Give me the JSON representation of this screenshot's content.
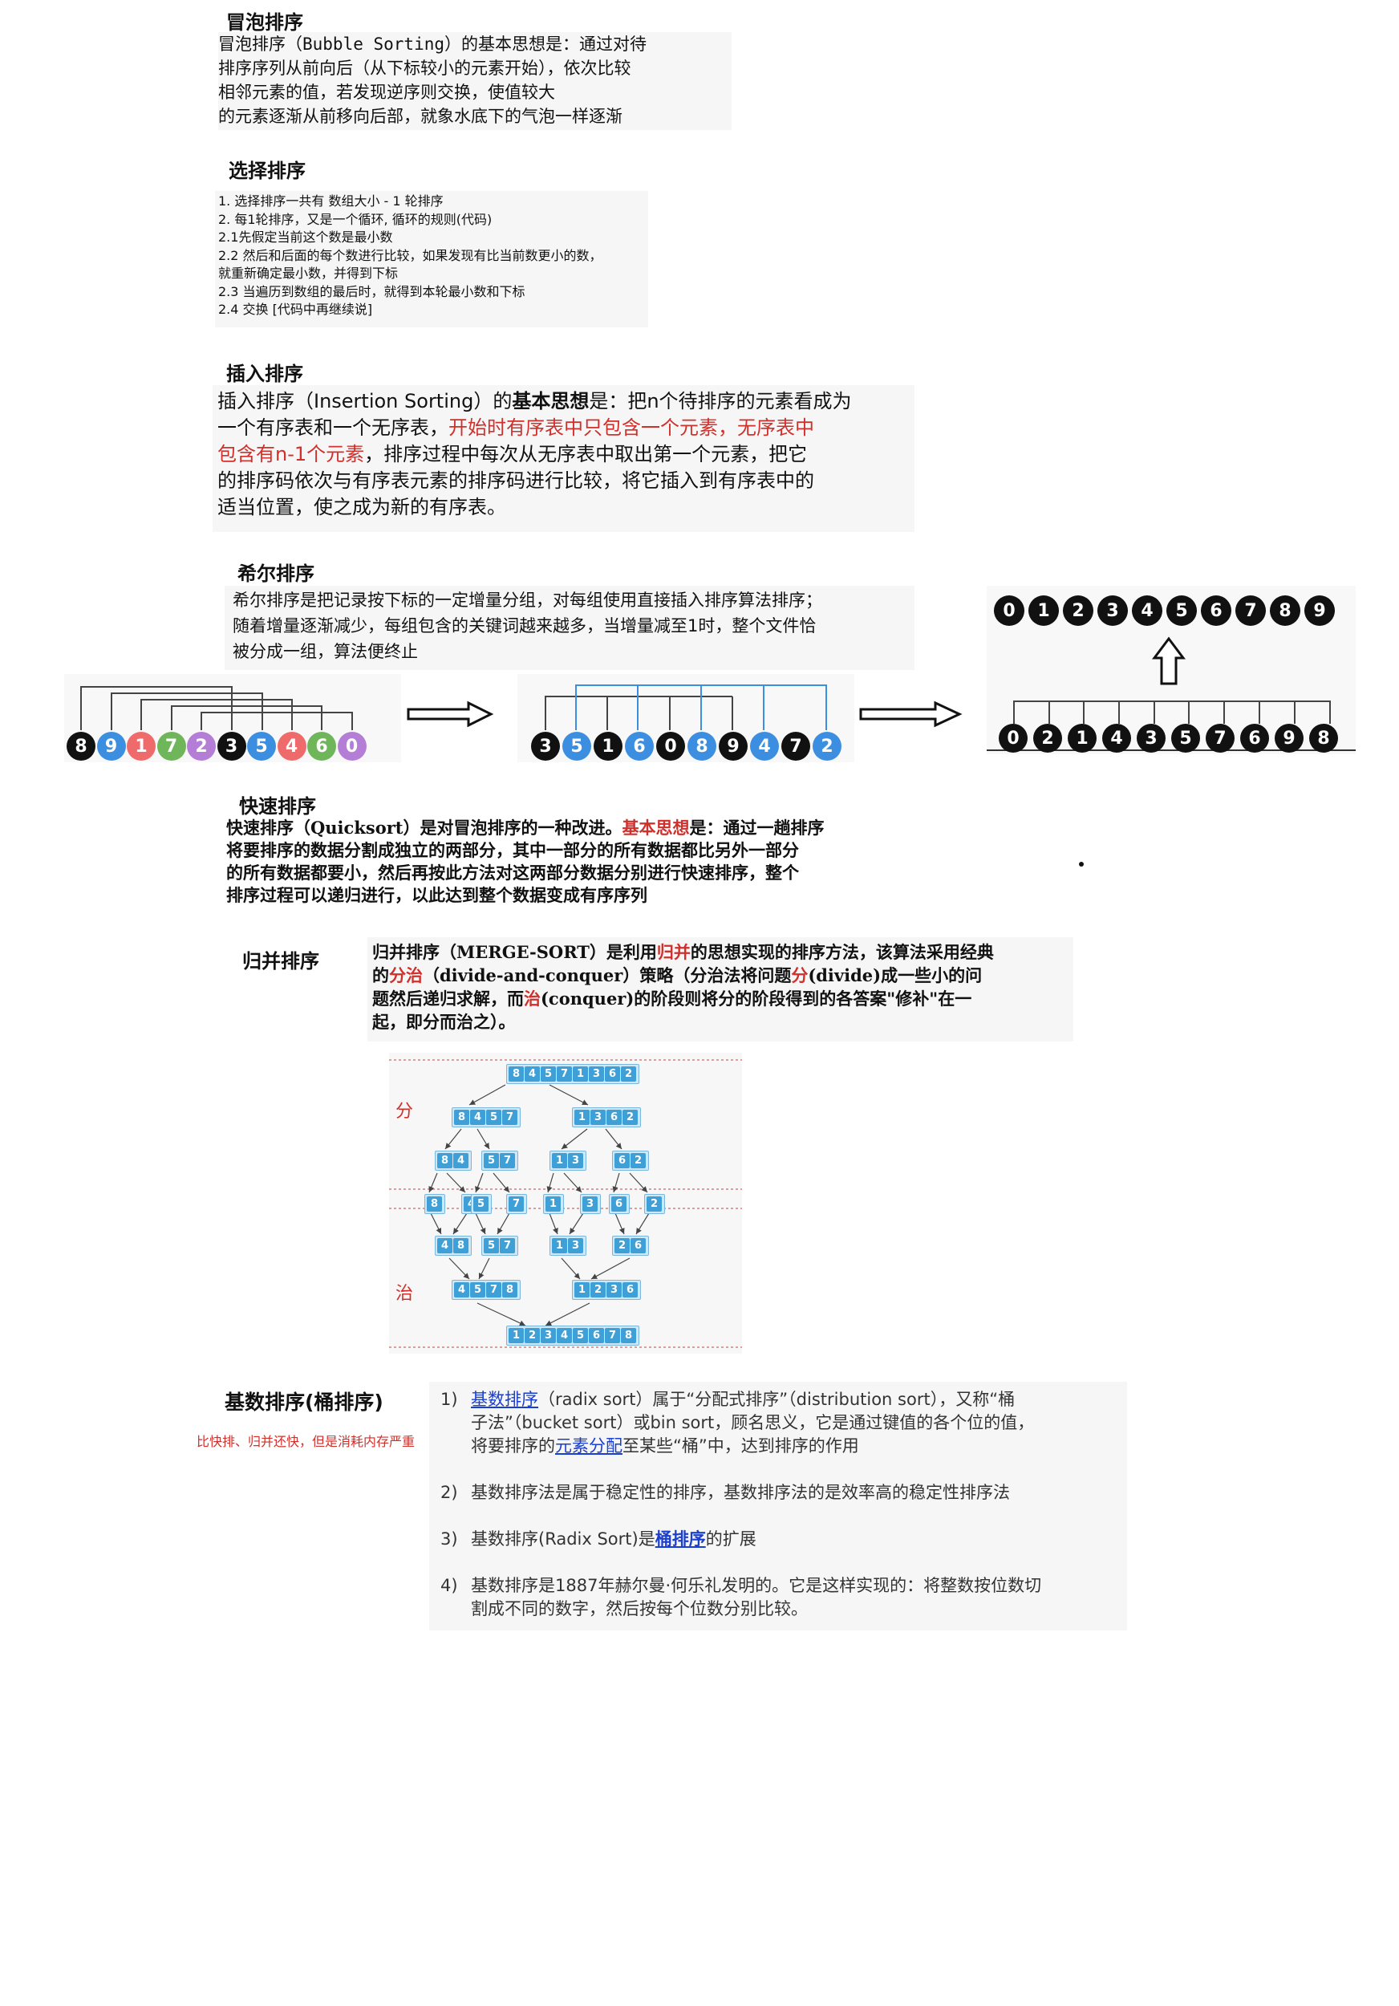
{
  "bubble": {
    "title": "冒泡排序",
    "lines": [
      "冒泡排序（Bubble Sorting）的基本思想是：通过对待",
      "排序序列从前向后（从下标较小的元素开始），依次比较",
      "相邻元素的值，若发现逆序则交换，使值较大",
      "的元素逐渐从前移向后部，就象水底下的气泡一样逐渐"
    ]
  },
  "selection": {
    "title": "选择排序",
    "items": [
      "1. 选择排序一共有 数组大小 - 1 轮排序",
      "2. 每1轮排序，又是一个循环, 循环的规则(代码)",
      "2.1先假定当前这个数是最小数",
      "2.2 然后和后面的每个数进行比较，如果发现有比当前数更小的数，",
      "就重新确定最小数，并得到下标",
      "2.3 当遍历到数组的最后时，就得到本轮最小数和下标",
      "2.4 交换 [代码中再继续说]"
    ]
  },
  "insertion": {
    "title": "插入排序",
    "l1_a": "插入排序（Insertion Sorting）的",
    "l1_b": "基本思想",
    "l1_c": "是：把n个待排序的元素看成为",
    "l2_a": "一个有序表和一个无序表，",
    "l2_b": "开始时有序表中只包含一个元素，无序表中",
    "l3_a": "包含有n-1个元素",
    "l3_b": "，排序过程中每次从无序表中取出第一个元素，把它",
    "l4": "的排序码依次与有序表元素的排序码进行比较，将它插入到有序表中的",
    "l5": "适当位置，使之成为新的有序表。"
  },
  "shell": {
    "title": "希尔排序",
    "lines": [
      "希尔排序是把记录按下标的一定增量分组，对每组使用直接插入排序算法排序；",
      "随着增量逐渐减少，每组包含的关键词越来越多，当增量减至1时，整个文件恰",
      "被分成一组，算法便终止"
    ],
    "row1": [
      {
        "v": "8",
        "c": "#111111"
      },
      {
        "v": "9",
        "c": "#3b8ee0"
      },
      {
        "v": "1",
        "c": "#ef6a6a"
      },
      {
        "v": "7",
        "c": "#6fb55a"
      },
      {
        "v": "2",
        "c": "#b57ed6"
      },
      {
        "v": "3",
        "c": "#111111"
      },
      {
        "v": "5",
        "c": "#3b8ee0"
      },
      {
        "v": "4",
        "c": "#ef6a6a"
      },
      {
        "v": "6",
        "c": "#6fb55a"
      },
      {
        "v": "0",
        "c": "#b57ed6"
      }
    ],
    "row2": [
      {
        "v": "3",
        "c": "#111111"
      },
      {
        "v": "5",
        "c": "#3b8ee0"
      },
      {
        "v": "1",
        "c": "#111111"
      },
      {
        "v": "6",
        "c": "#3b8ee0"
      },
      {
        "v": "0",
        "c": "#111111"
      },
      {
        "v": "8",
        "c": "#3b8ee0"
      },
      {
        "v": "9",
        "c": "#111111"
      },
      {
        "v": "4",
        "c": "#3b8ee0"
      },
      {
        "v": "7",
        "c": "#111111"
      },
      {
        "v": "2",
        "c": "#3b8ee0"
      }
    ],
    "row3": [
      "0",
      "2",
      "1",
      "4",
      "3",
      "5",
      "7",
      "6",
      "9",
      "8"
    ],
    "row4": [
      "0",
      "1",
      "2",
      "3",
      "4",
      "5",
      "6",
      "7",
      "8",
      "9"
    ]
  },
  "quick": {
    "title": "快速排序",
    "l1_a": "快速排序（Quicksort）是对冒泡排序的一种改进。",
    "l1_b": "基本思想",
    "l1_c": "是：通过一趟排序",
    "l2": "将要排序的数据分割成独立的两部分，其中一部分的所有数据都比另外一部分",
    "l3": "的所有数据都要小，然后再按此方法对这两部分数据分别进行快速排序，整个",
    "l4": "排序过程可以递归进行，以此达到整个数据变成有序序列"
  },
  "merge": {
    "title": "归并排序",
    "l1_a": "归并排序（MERGE-SORT）是利用",
    "l1_b": "归并",
    "l1_c": "的思想实现的排序方法，该算法采用经典",
    "l2_a": "的",
    "l2_b": "分治",
    "l2_c": "（divide-and-conquer）策略（分治法将问题",
    "l2_d": "分",
    "l2_e": "(divide)成一些小的问",
    "l3_a": "题然后递归求解，而",
    "l3_b": "治",
    "l3_c": "(conquer)的阶段则将分的阶段得到的各答案\"修补\"在一",
    "l4": "起，即分而治之）。",
    "divide_label": "分",
    "conquer_label": "治",
    "levels": {
      "top": [
        "8",
        "4",
        "5",
        "7",
        "1",
        "3",
        "6",
        "2"
      ],
      "d1": [
        [
          "8",
          "4",
          "5",
          "7"
        ],
        [
          "1",
          "3",
          "6",
          "2"
        ]
      ],
      "d2": [
        [
          "8",
          "4"
        ],
        [
          "5",
          "7"
        ],
        [
          "1",
          "3"
        ],
        [
          "6",
          "2"
        ]
      ],
      "d3": [
        "8",
        "4",
        "5",
        "7",
        "1",
        "3",
        "6",
        "2"
      ],
      "c1": [
        [
          "4",
          "8"
        ],
        [
          "5",
          "7"
        ],
        [
          "1",
          "3"
        ],
        [
          "2",
          "6"
        ]
      ],
      "c2": [
        [
          "4",
          "5",
          "7",
          "8"
        ],
        [
          "1",
          "2",
          "3",
          "6"
        ]
      ],
      "c3": [
        "1",
        "2",
        "3",
        "4",
        "5",
        "6",
        "7",
        "8"
      ]
    }
  },
  "radix": {
    "title": "基数排序(桶排序)",
    "note": "比快排、归并还快，但是消耗内存严重",
    "i1_num": "1)",
    "i1_a": "基数排序",
    "i1_b": "（radix sort）属于“分配式排序”（distribution sort），又称“桶",
    "i1_c": "子法”（bucket sort）或bin sort，顾名思义，它是通过键值的各个位的值，",
    "i1_d": "将要排序的",
    "i1_e": "元素分配",
    "i1_f": "至某些“桶”中，达到排序的作用",
    "i2_num": "2)",
    "i2": "基数排序法是属于稳定性的排序，基数排序法的是效率高的稳定性排序法",
    "i3_num": "3)",
    "i3_a": "基数排序(Radix Sort)是",
    "i3_b": "桶排序",
    "i3_c": "的扩展",
    "i4_num": "4)",
    "i4_a": "基数排序是1887年赫尔曼·何乐礼发明的。它是这样实现的：将整数按位数切",
    "i4_b": "割成不同的数字，然后按每个位数分别比较。"
  }
}
